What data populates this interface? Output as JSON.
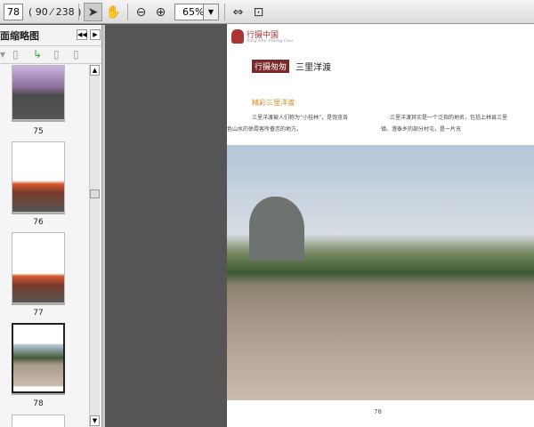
{
  "toolbar": {
    "page_number": "78",
    "page_count": "( 90 ⁄ 238 )",
    "zoom": "65%",
    "icons": [
      "select-arrow-icon",
      "hand-icon",
      "zoom-out-icon",
      "zoom-in-icon",
      "fit-width-icon",
      "fit-page-icon"
    ]
  },
  "sidebar": {
    "title": "面缩略图",
    "thumbnails": [
      {
        "label": "75"
      },
      {
        "label": "76"
      },
      {
        "label": "77"
      },
      {
        "label": "78",
        "selected": true
      }
    ]
  },
  "page": {
    "brand": "行摄中国",
    "brand_sub": "Xing She Zhong Guo",
    "badge": "行摄匆匆",
    "section_title": "三里洋渡",
    "subheading": "精彩三里洋渡",
    "para_left": "三里洋渡被人们称为“小桂林”，是饱览各色山水的徐霞客所眷恋的地方。",
    "para_right": "三里洋渡其实是一个泛指的地名，包括上林县三里镇、澄泰乡的部分村屯，是一片充",
    "page_number": "78"
  },
  "colors": {
    "accent": "#7a2a2a",
    "subheading": "#d98b2b"
  }
}
